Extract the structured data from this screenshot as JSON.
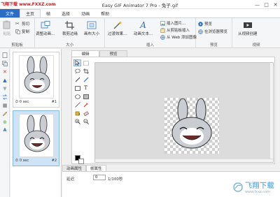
{
  "window": {
    "title": "Easy GIF Animator 7 Pro - 兔子.gif",
    "watermark_top": "飞翔下载 www.FXXZ.com",
    "controls": [
      "—",
      "□",
      "✕"
    ]
  },
  "menu": {
    "file": "文件",
    "tabs": [
      "主页",
      "帧",
      "选择",
      "动画",
      "帮助"
    ],
    "active": "主页"
  },
  "ribbon": {
    "clipboard": {
      "paste": "粘贴",
      "cut": "剪切",
      "copy": "复制",
      "label": "剪贴板"
    },
    "size": {
      "resize_animation": "调整动画...",
      "crop_canvas": "裁剪边缘",
      "canvas_size": "画布大小",
      "label": "大小"
    },
    "insert": {
      "transition_effect": "过渡效果...",
      "animated_text": "动画文本...",
      "insert_image": "插入图片...",
      "from_clipboard": "从剪贴板插入",
      "from_web": "从 Web 添加图像",
      "label": "插入"
    },
    "preview": {
      "preview": "预览",
      "browser_preview": "在浏览器预览",
      "label": "预览"
    },
    "video": {
      "from_video": "从视频创建",
      "label": "视频"
    }
  },
  "frames": [
    {
      "time": "0 sec",
      "number": "#1"
    },
    {
      "time": "0 sec",
      "number": "#2"
    }
  ],
  "editor": {
    "tabs": [
      "编辑",
      "预览"
    ],
    "active_tab": "编辑"
  },
  "properties": {
    "tabs": [
      "动画属性",
      "帧属性"
    ],
    "active_tab": "帧属性",
    "delay_label": "延迟",
    "delay_value": "0",
    "delay_unit": "1/100秒"
  },
  "watermark_bottom": {
    "text": "飞翔下载",
    "sub": "www.fxxz.com"
  },
  "colors": {
    "accent": "#2b6cc4",
    "selection": "#cfe3f7",
    "fg_color": "#000000",
    "bg_color": "#ffffff"
  }
}
